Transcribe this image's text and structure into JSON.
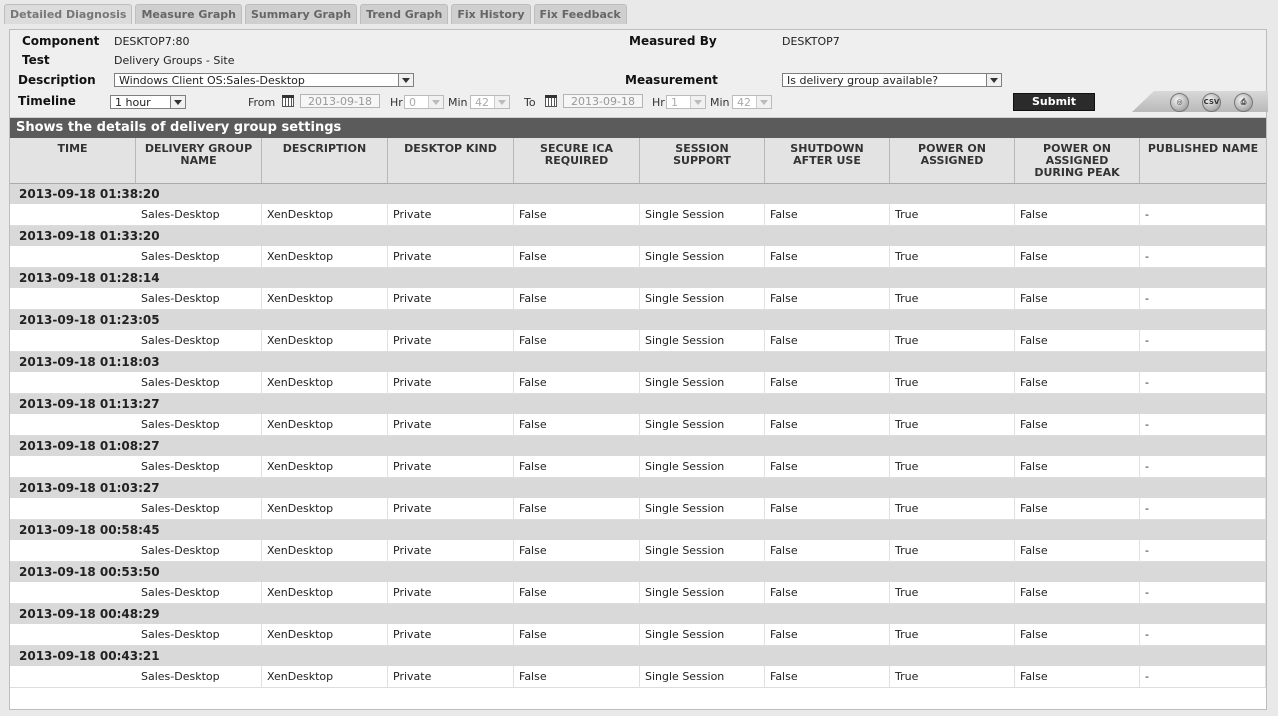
{
  "tabs": [
    {
      "label": "Detailed Diagnosis",
      "active": true
    },
    {
      "label": "Measure Graph"
    },
    {
      "label": "Summary Graph"
    },
    {
      "label": "Trend Graph"
    },
    {
      "label": "Fix History"
    },
    {
      "label": "Fix Feedback"
    }
  ],
  "filters": {
    "component_label": "Component",
    "component_value": "DESKTOP7:80",
    "test_label": "Test",
    "test_value": "Delivery Groups - Site",
    "description_label": "Description",
    "description_value": "Windows Client OS:Sales-Desktop",
    "timeline_label": "Timeline",
    "timeline_value": "1 hour",
    "measured_by_label": "Measured By",
    "measured_by_value": "DESKTOP7",
    "measurement_label": "Measurement",
    "measurement_value": "Is delivery group available?",
    "from_label": "From",
    "from_date": "2013-09-18",
    "from_hr_label": "Hr",
    "from_hr": "0",
    "from_min_label": "Min",
    "from_min": "42",
    "to_label": "To",
    "to_date": "2013-09-18",
    "to_hr_label": "Hr",
    "to_hr": "1",
    "to_min_label": "Min",
    "to_min": "42",
    "submit_label": "Submit",
    "icons": [
      "binoculars-icon",
      "csv-icon",
      "print-icon"
    ],
    "csv_text": "CSV"
  },
  "section_title": "Shows the details of delivery group settings",
  "table": {
    "columns": [
      "TIME",
      "DELIVERY GROUP NAME",
      "DESCRIPTION",
      "DESKTOP KIND",
      "SECURE ICA REQUIRED",
      "SESSION SUPPORT",
      "SHUTDOWN AFTER USE",
      "POWER ON ASSIGNED",
      "POWER ON ASSIGNED DURING PEAK",
      "PUBLISHED NAME"
    ],
    "groups": [
      {
        "time": "2013-09-18 01:38:20",
        "row": [
          "Sales-Desktop",
          "XenDesktop",
          "Private",
          "False",
          "Single Session",
          "False",
          "True",
          "False",
          "-"
        ]
      },
      {
        "time": "2013-09-18 01:33:20",
        "row": [
          "Sales-Desktop",
          "XenDesktop",
          "Private",
          "False",
          "Single Session",
          "False",
          "True",
          "False",
          "-"
        ]
      },
      {
        "time": "2013-09-18 01:28:14",
        "row": [
          "Sales-Desktop",
          "XenDesktop",
          "Private",
          "False",
          "Single Session",
          "False",
          "True",
          "False",
          "-"
        ]
      },
      {
        "time": "2013-09-18 01:23:05",
        "row": [
          "Sales-Desktop",
          "XenDesktop",
          "Private",
          "False",
          "Single Session",
          "False",
          "True",
          "False",
          "-"
        ]
      },
      {
        "time": "2013-09-18 01:18:03",
        "row": [
          "Sales-Desktop",
          "XenDesktop",
          "Private",
          "False",
          "Single Session",
          "False",
          "True",
          "False",
          "-"
        ]
      },
      {
        "time": "2013-09-18 01:13:27",
        "row": [
          "Sales-Desktop",
          "XenDesktop",
          "Private",
          "False",
          "Single Session",
          "False",
          "True",
          "False",
          "-"
        ]
      },
      {
        "time": "2013-09-18 01:08:27",
        "row": [
          "Sales-Desktop",
          "XenDesktop",
          "Private",
          "False",
          "Single Session",
          "False",
          "True",
          "False",
          "-"
        ]
      },
      {
        "time": "2013-09-18 01:03:27",
        "row": [
          "Sales-Desktop",
          "XenDesktop",
          "Private",
          "False",
          "Single Session",
          "False",
          "True",
          "False",
          "-"
        ]
      },
      {
        "time": "2013-09-18 00:58:45",
        "row": [
          "Sales-Desktop",
          "XenDesktop",
          "Private",
          "False",
          "Single Session",
          "False",
          "True",
          "False",
          "-"
        ]
      },
      {
        "time": "2013-09-18 00:53:50",
        "row": [
          "Sales-Desktop",
          "XenDesktop",
          "Private",
          "False",
          "Single Session",
          "False",
          "True",
          "False",
          "-"
        ]
      },
      {
        "time": "2013-09-18 00:48:29",
        "row": [
          "Sales-Desktop",
          "XenDesktop",
          "Private",
          "False",
          "Single Session",
          "False",
          "True",
          "False",
          "-"
        ]
      },
      {
        "time": "2013-09-18 00:43:21",
        "row": [
          "Sales-Desktop",
          "XenDesktop",
          "Private",
          "False",
          "Single Session",
          "False",
          "True",
          "False",
          "-"
        ]
      }
    ]
  }
}
